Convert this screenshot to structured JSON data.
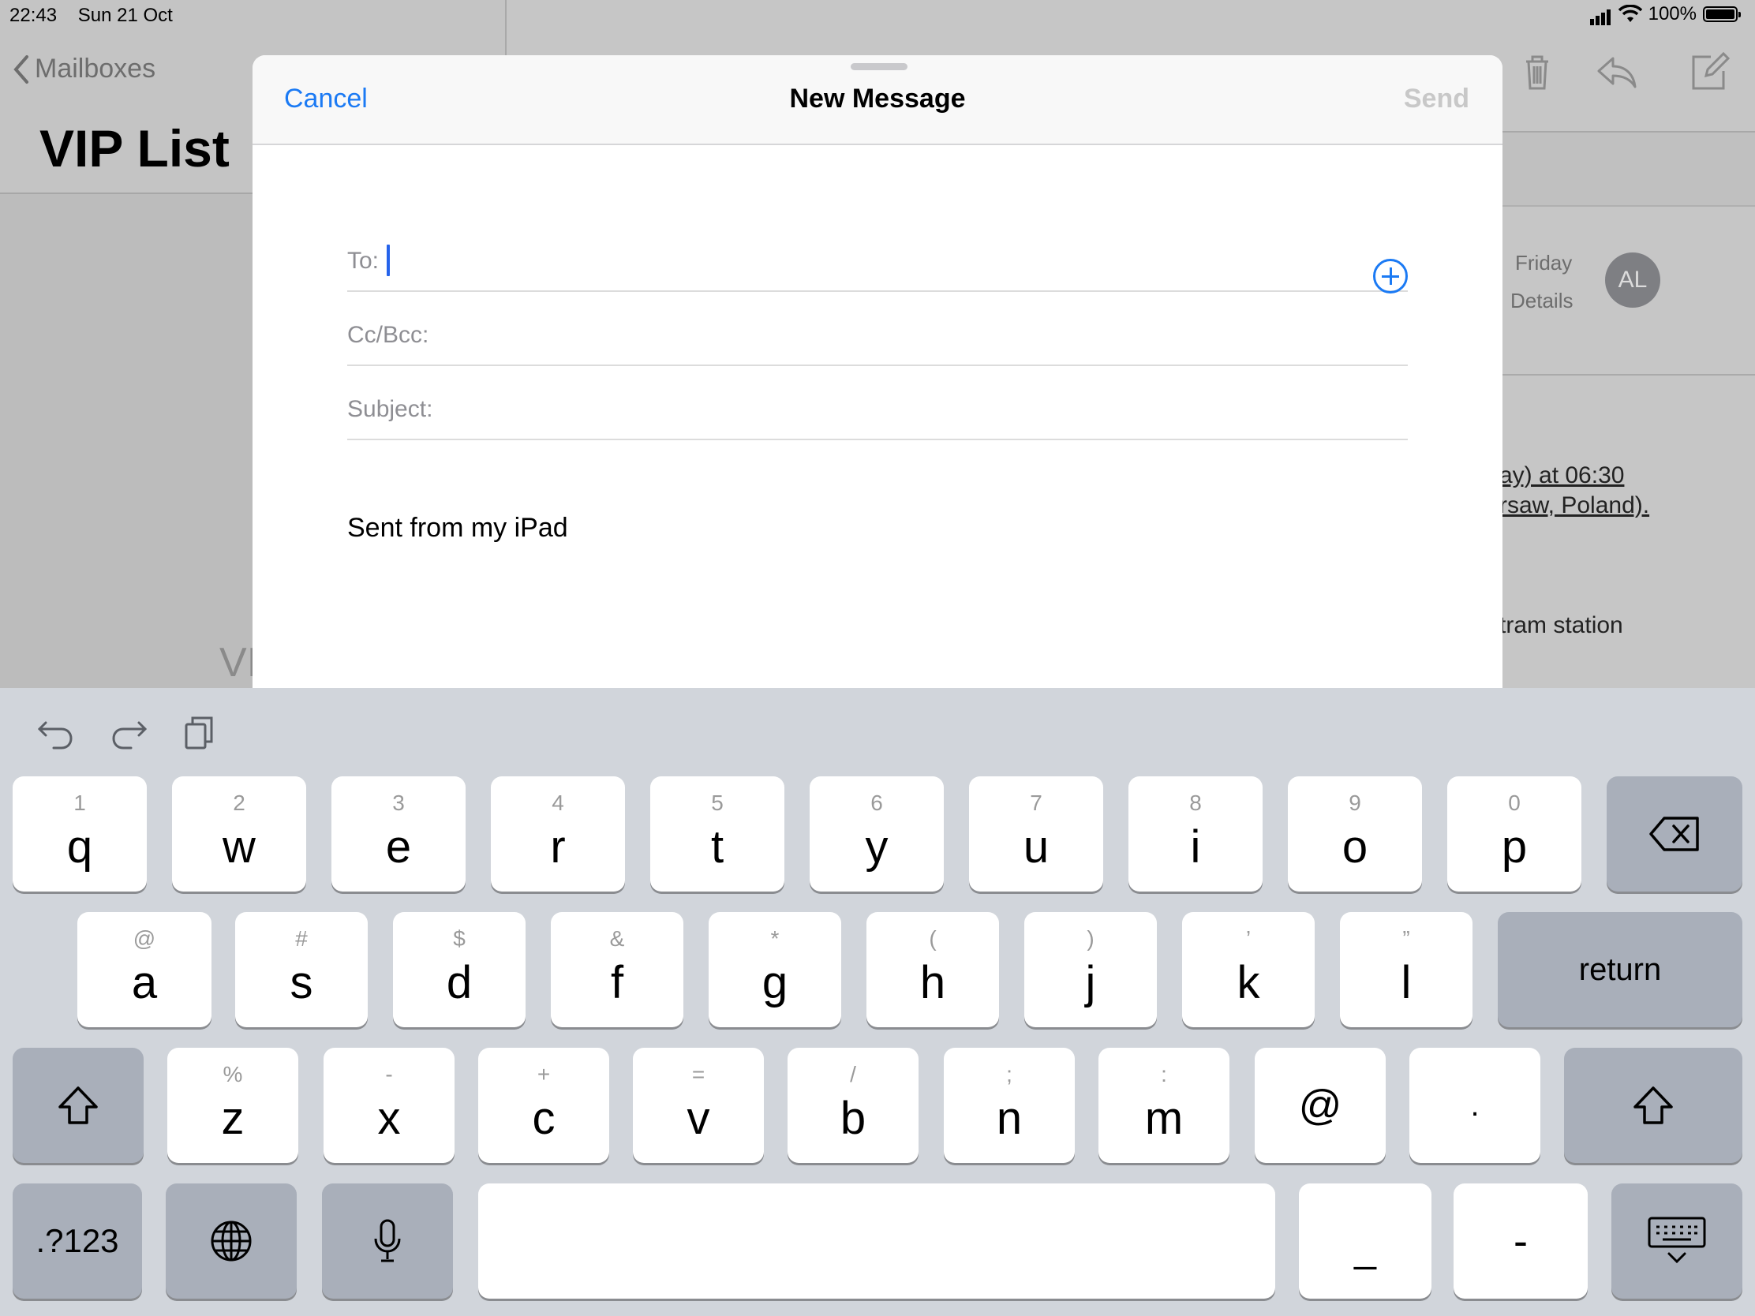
{
  "status_bar": {
    "time": "22:43",
    "date": "Sun 21 Oct",
    "battery": "100%"
  },
  "background": {
    "back_label": "Mailboxes",
    "list_title": "VIP List",
    "list_fragment": "VI",
    "detail": {
      "date": "Friday",
      "details_link": "Details",
      "avatar_initials": "AL",
      "line1": "ay) at 06:30",
      "line2": "rsaw, Poland).",
      "line3": "tram station"
    }
  },
  "compose": {
    "cancel_label": "Cancel",
    "title": "New Message",
    "send_label": "Send",
    "to_label": "To:",
    "cc_label": "Cc/Bcc:",
    "subject_label": "Subject:",
    "signature": "Sent from my iPad"
  },
  "keyboard": {
    "row1": [
      {
        "alt": "1",
        "key": "q"
      },
      {
        "alt": "2",
        "key": "w"
      },
      {
        "alt": "3",
        "key": "e"
      },
      {
        "alt": "4",
        "key": "r"
      },
      {
        "alt": "5",
        "key": "t"
      },
      {
        "alt": "6",
        "key": "y"
      },
      {
        "alt": "7",
        "key": "u"
      },
      {
        "alt": "8",
        "key": "i"
      },
      {
        "alt": "9",
        "key": "o"
      },
      {
        "alt": "0",
        "key": "p"
      }
    ],
    "row2": [
      {
        "alt": "@",
        "key": "a"
      },
      {
        "alt": "#",
        "key": "s"
      },
      {
        "alt": "$",
        "key": "d"
      },
      {
        "alt": "&",
        "key": "f"
      },
      {
        "alt": "*",
        "key": "g"
      },
      {
        "alt": "(",
        "key": "h"
      },
      {
        "alt": ")",
        "key": "j"
      },
      {
        "alt": "’",
        "key": "k"
      },
      {
        "alt": "”",
        "key": "l"
      }
    ],
    "row3": [
      {
        "alt": "%",
        "key": "z"
      },
      {
        "alt": "-",
        "key": "x"
      },
      {
        "alt": "+",
        "key": "c"
      },
      {
        "alt": "=",
        "key": "v"
      },
      {
        "alt": "/",
        "key": "b"
      },
      {
        "alt": ";",
        "key": "n"
      },
      {
        "alt": ":",
        "key": "m"
      }
    ],
    "at_key": "@",
    "dot_key": ".",
    "return_label": "return",
    "numbers_label": ".?123",
    "underscore_key": "_",
    "dash_key": "-"
  },
  "colors": {
    "accent": "#1b7af4",
    "caret": "#2563eb",
    "keyboard_bg": "#d1d5db"
  }
}
